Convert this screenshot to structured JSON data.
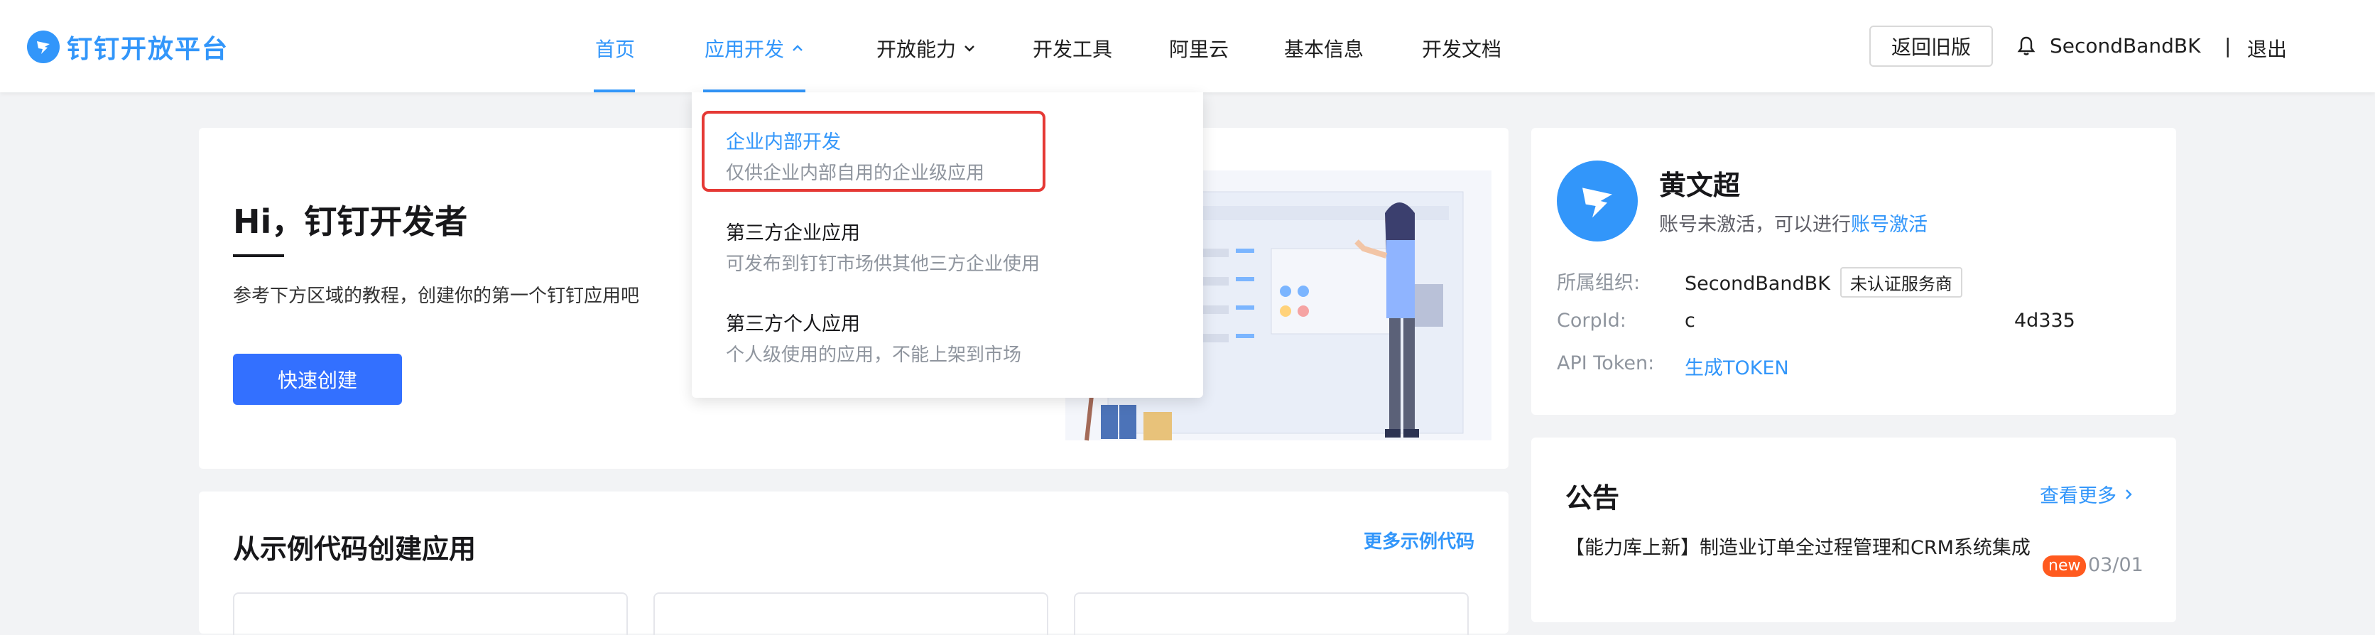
{
  "header": {
    "brand": "钉钉开放平台",
    "nav": [
      {
        "label": "首页",
        "active": true
      },
      {
        "label": "应用开发",
        "open": true
      },
      {
        "label": "开放能力"
      },
      {
        "label": "开发工具"
      },
      {
        "label": "阿里云"
      },
      {
        "label": "基本信息"
      },
      {
        "label": "开发文档"
      }
    ],
    "back_old": "返回旧版",
    "user": "SecondBandBK",
    "separator": "|",
    "logout": "退出"
  },
  "dropdown": {
    "items": [
      {
        "title": "企业内部开发",
        "desc": "仅供企业内部自用的企业级应用",
        "selected": true
      },
      {
        "title": "第三方企业应用",
        "desc": "可发布到钉钉市场供其他三方企业使用"
      },
      {
        "title": "第三方个人应用",
        "desc": "个人级使用的应用，不能上架到市场"
      }
    ]
  },
  "welcome": {
    "title": "Hi，钉钉开发者",
    "desc": "参考下方区域的教程，创建你的第一个钉钉应用吧",
    "button": "快速创建"
  },
  "examples": {
    "title": "从示例代码创建应用",
    "more": "更多示例代码"
  },
  "profile": {
    "name": "黄文超",
    "status_prefix": "账号未激活，可以进行",
    "status_link": "账号激活",
    "org_label": "所属组织:",
    "org_value": "SecondBandBK",
    "org_badge": "未认证服务商",
    "corpid_label": "CorpId:",
    "corpid_start": "c",
    "corpid_end": "4d335",
    "token_label": "API Token:",
    "token_link": "生成TOKEN"
  },
  "notice": {
    "title": "公告",
    "more": "查看更多",
    "items": [
      {
        "text": "【能力库上新】制造业订单全过程管理和CRM系统集成",
        "tag": "new",
        "date": "03/01"
      }
    ]
  },
  "colors": {
    "accent": "#3296fa",
    "button": "#3370ff",
    "highlight": "#e53935",
    "new_tag": "#ff5a1f"
  }
}
